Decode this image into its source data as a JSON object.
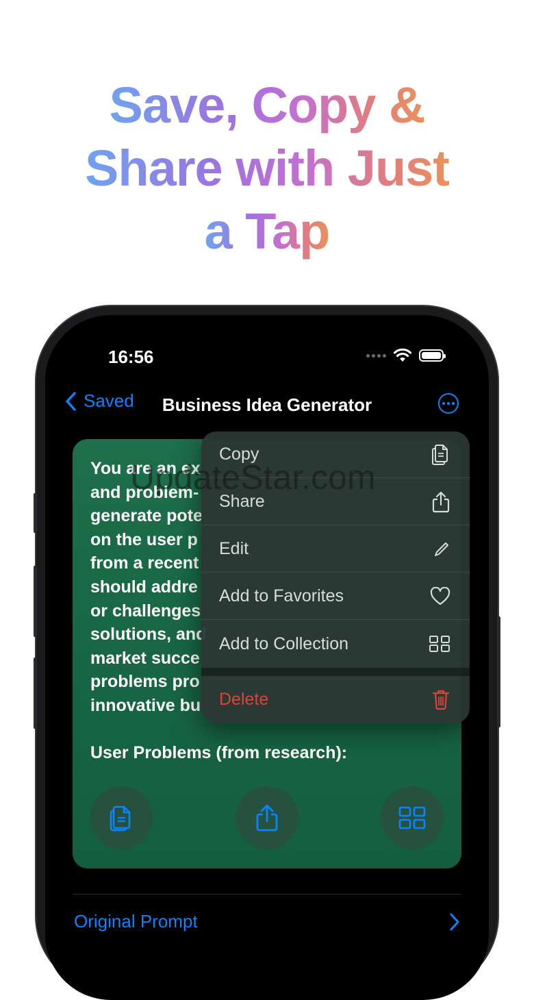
{
  "headline": {
    "line1": "Save, Copy &",
    "line2": "Share with Just",
    "line3": "a Tap"
  },
  "status_bar": {
    "time": "16:56",
    "icons": [
      "signal-dots-icon",
      "wifi-icon",
      "battery-icon"
    ]
  },
  "nav": {
    "back_label": "Saved",
    "title": "Business Idea Generator",
    "more_icon": "ellipsis-circle-icon"
  },
  "card": {
    "lines": [
      "You are an ex",
      "and problem-",
      "generate pote",
      "on the user p",
      "from a recent",
      "should addre",
      "or challenges",
      "solutions, and",
      "market succe",
      "problems pro",
      "innovative bu"
    ],
    "user_problems": "User Problems (from research):",
    "actions": [
      {
        "icon": "copy-icon"
      },
      {
        "icon": "share-icon"
      },
      {
        "icon": "collection-icon"
      }
    ]
  },
  "menu": {
    "items": [
      {
        "label": "Copy",
        "icon": "copy-icon"
      },
      {
        "label": "Share",
        "icon": "share-icon"
      },
      {
        "label": "Edit",
        "icon": "pencil-icon"
      },
      {
        "label": "Add to Favorites",
        "icon": "heart-icon"
      },
      {
        "label": "Add to Collection",
        "icon": "grid-icon"
      },
      {
        "label": "Delete",
        "icon": "trash-icon"
      }
    ]
  },
  "original_prompt": {
    "label": "Original Prompt"
  },
  "watermark": "UpdateStar.com",
  "colors": {
    "accent": "#0a84ff",
    "card": "#1b6a47",
    "delete": "#d9453a",
    "menu_bg": "#2c3632"
  }
}
